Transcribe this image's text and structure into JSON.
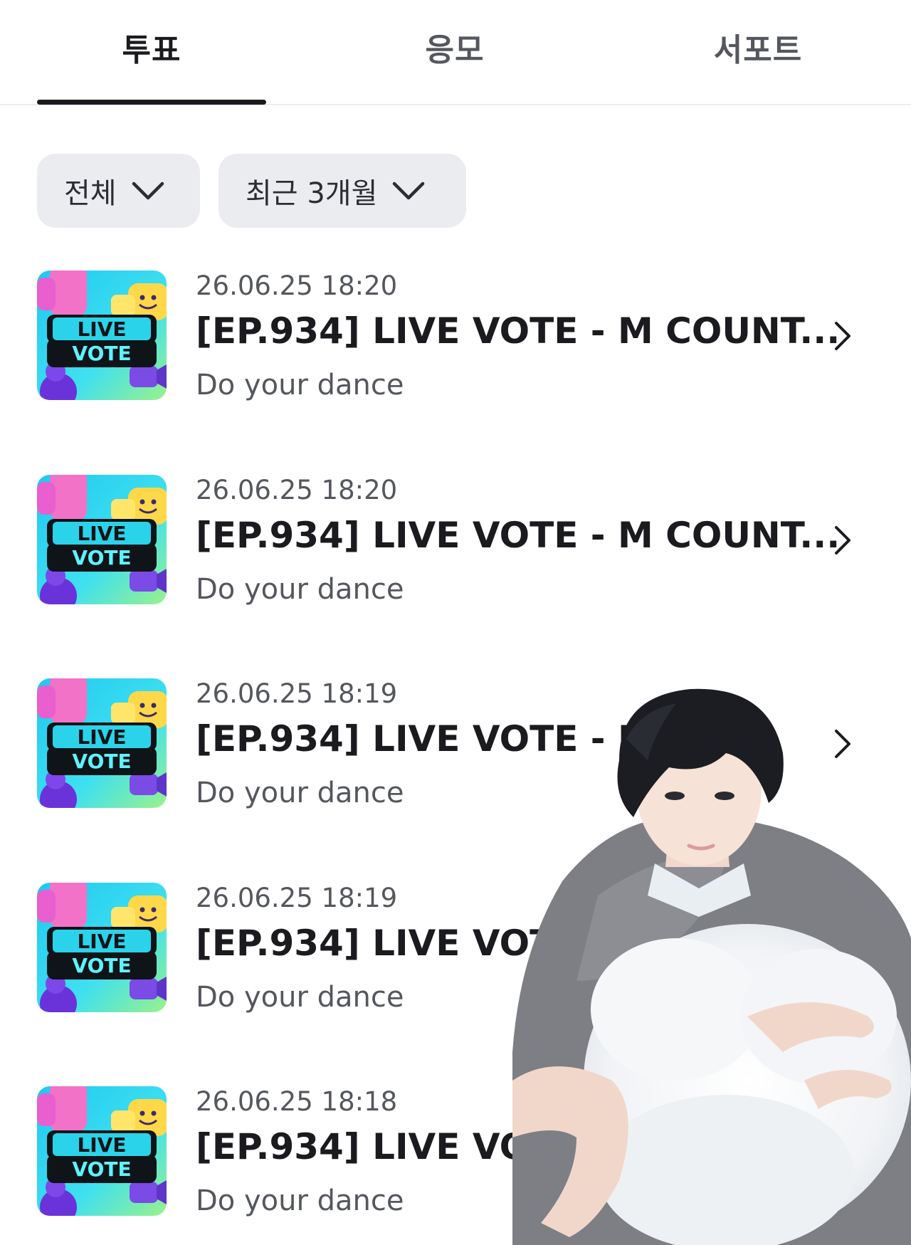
{
  "tabs": [
    {
      "label": "투표",
      "active": true
    },
    {
      "label": "응모",
      "active": false
    },
    {
      "label": "서포트",
      "active": false
    }
  ],
  "filters": {
    "category": {
      "label": "전체",
      "icon": "chevron-down-icon"
    },
    "period": {
      "label": "최근 3개월",
      "icon": "chevron-down-icon"
    }
  },
  "items": [
    {
      "thumb_top": "LIVE",
      "thumb_bottom": "VOTE",
      "date": "26.06.25 18:20",
      "title": "[EP.934] LIVE VOTE - M COUNT...",
      "subtitle": "Do your dance",
      "icon": "chevron-right-icon"
    },
    {
      "thumb_top": "LIVE",
      "thumb_bottom": "VOTE",
      "date": "26.06.25 18:20",
      "title": "[EP.934] LIVE VOTE - M COUNT...",
      "subtitle": "Do your dance",
      "icon": "chevron-right-icon"
    },
    {
      "thumb_top": "LIVE",
      "thumb_bottom": "VOTE",
      "date": "26.06.25 18:19",
      "title": "[EP.934] LIVE VOTE - M C",
      "subtitle": "Do your dance",
      "icon": "chevron-right-icon"
    },
    {
      "thumb_top": "LIVE",
      "thumb_bottom": "VOTE",
      "date": "26.06.25 18:19",
      "title": "[EP.934] LIVE VOTI",
      "subtitle": "Do your dance",
      "icon": "chevron-right-icon"
    },
    {
      "thumb_top": "LIVE",
      "thumb_bottom": "VOTE",
      "date": "26.06.25 18:18",
      "title": "[EP.934] LIVE VOTE - M C",
      "subtitle": "Do your dance",
      "icon": "chevron-right-icon"
    }
  ],
  "colors": {
    "text_primary": "#1b1b1f",
    "text_secondary": "#55575e",
    "chip_bg": "#ebecef",
    "thumb_bg": "#3fd7ef",
    "thumb_label_bg": "#0f1418",
    "thumb_label_text": "#5ef3ff"
  }
}
